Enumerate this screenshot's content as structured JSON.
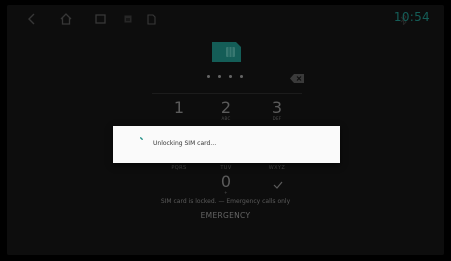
{
  "status_bar": {
    "time": "10:54",
    "icons": [
      "back-icon",
      "home-icon",
      "recents-icon",
      "screenshot-icon",
      "sim-status-icon",
      "bluetooth-icon"
    ]
  },
  "colors": {
    "accent": "#1f8f86",
    "background": "#151515",
    "dialog_bg": "#fafafa"
  },
  "keypad": {
    "keys": [
      {
        "digit": "1",
        "letters": ""
      },
      {
        "digit": "2",
        "letters": "ABC"
      },
      {
        "digit": "3",
        "letters": "DEF"
      },
      {
        "digit": "0",
        "letters": "+"
      }
    ],
    "row_letters": [
      "PQRS",
      "TUV",
      "WXYZ"
    ]
  },
  "message": "SIM card is locked. — Emergency calls only",
  "emergency_label": "EMERGENCY",
  "dialog": {
    "text": "Unlocking SIM card…"
  }
}
